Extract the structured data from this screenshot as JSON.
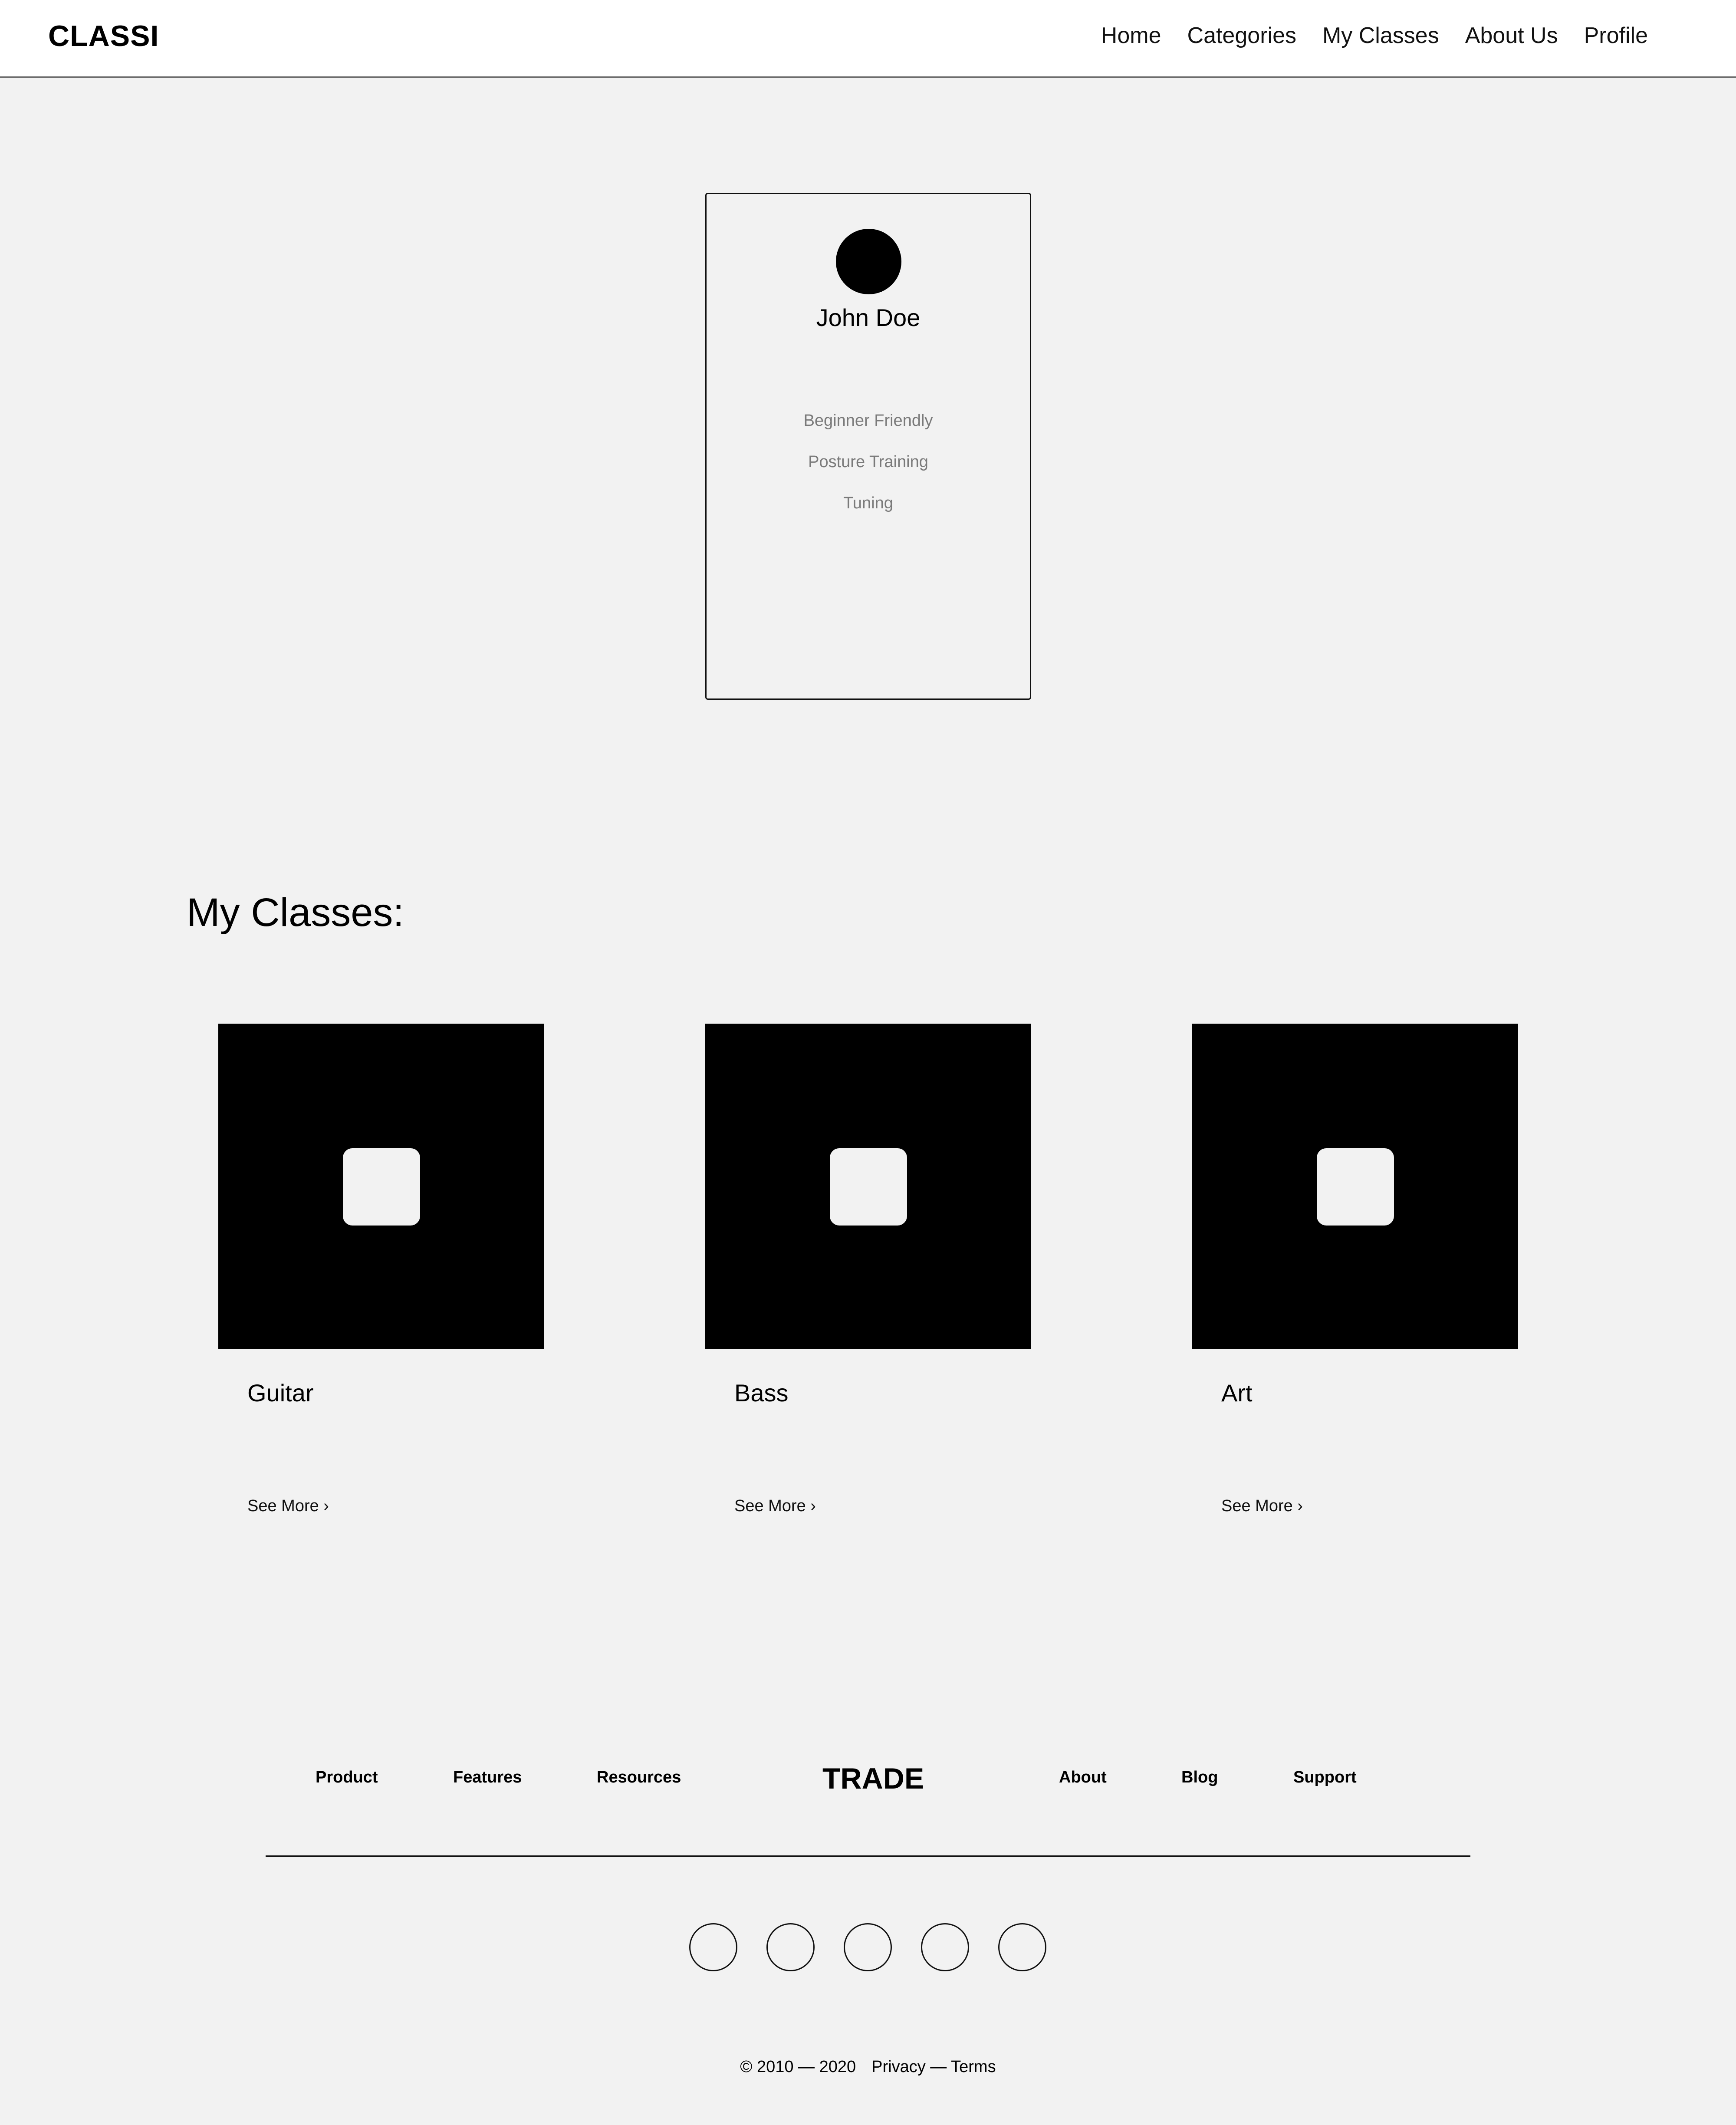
{
  "header": {
    "brand": "CLASSI",
    "nav": [
      "Home",
      "Categories",
      "My Classes",
      "About Us",
      "Profile"
    ]
  },
  "profile": {
    "name": "John Doe",
    "tags": [
      "Beginner Friendly",
      "Posture Training",
      "Tuning"
    ]
  },
  "classes": {
    "title": "My Classes:",
    "items": [
      {
        "name": "Guitar",
        "link": "See More ›"
      },
      {
        "name": "Bass",
        "link": "See More ›"
      },
      {
        "name": "Art",
        "link": "See More ›"
      }
    ]
  },
  "footer": {
    "left_links": [
      "Product",
      "Features",
      "Resources"
    ],
    "brand": "TRADE",
    "right_links": [
      "About",
      "Blog",
      "Support"
    ],
    "copyright": "© 2010 — 2020",
    "legal": "Privacy — Terms"
  }
}
